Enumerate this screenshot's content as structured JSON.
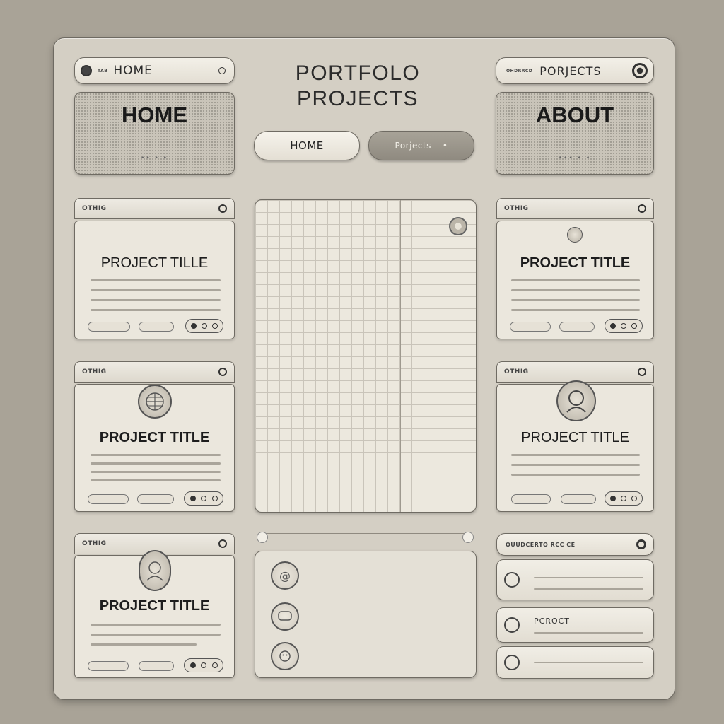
{
  "header": {
    "title_line1": "PORTFOLO",
    "title_line2": "PROJECTS",
    "left_tab": {
      "tag": "TAB",
      "label": "HOME"
    },
    "right_tab": {
      "tag": "OHDRRCD",
      "label": "PORJECTS"
    }
  },
  "hero": {
    "left": {
      "title": "HOME",
      "dots": "•• • •"
    },
    "right": {
      "title": "ABOUT",
      "dots": "••• • •"
    }
  },
  "nav": {
    "home_label": "HOME",
    "projects_label": "Porjects",
    "projects_mark": "•"
  },
  "cards": [
    {
      "tag": "OTHIG",
      "title": "PROJECT TILLE"
    },
    {
      "tag": "OTHIG",
      "title": "PROJECT TITLE"
    },
    {
      "tag": "OTHIG",
      "title": "PROJECT TITLE"
    },
    {
      "tag": "OTHIG",
      "title": "PROJECT TITLE"
    },
    {
      "tag": "OTHIG",
      "title": "PROJECT TITLE"
    }
  ],
  "list_panel": {
    "header_tag": "OUUDCERTO RCC CE",
    "items": [
      {
        "label": ""
      },
      {
        "label": "PCROCT"
      },
      {
        "label": ""
      }
    ]
  },
  "colors": {
    "background": "#a9a397",
    "board": "#d4cfc4",
    "ink": "#1d1d1d"
  }
}
